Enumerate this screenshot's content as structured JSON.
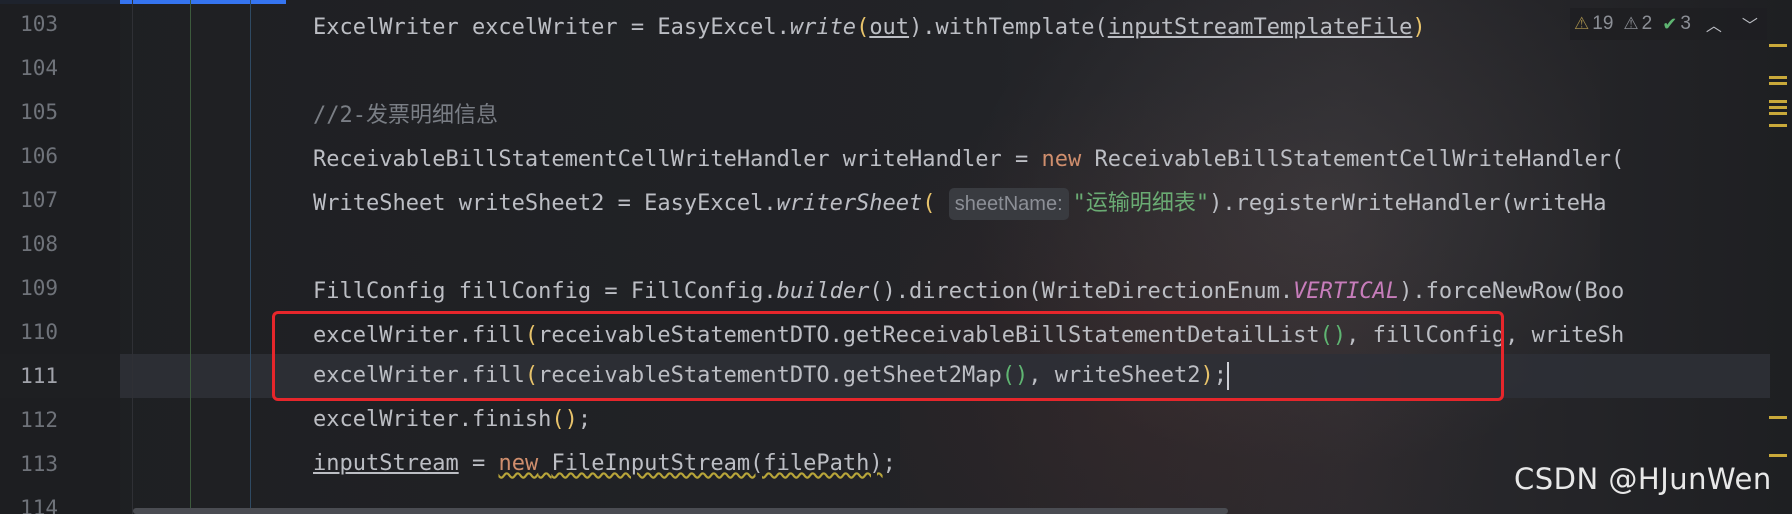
{
  "editor": {
    "line_numbers": [
      "103",
      "104",
      "105",
      "106",
      "107",
      "108",
      "109",
      "110",
      "111",
      "112",
      "113",
      "114"
    ],
    "current_line": "111"
  },
  "code": {
    "l103": {
      "a": "ExcelWriter excelWriter = EasyExcel.",
      "b": "write",
      "c": "(",
      "d": "out",
      "e": ").withTemplate(",
      "f": "inputStreamTemplateFile",
      "g": ")"
    },
    "l105": {
      "comment": "//2-发票明细信息"
    },
    "l106": {
      "a": "ReceivableBillStatementCellWriteHandler writeHandler = ",
      "kw": "new",
      "b": " ReceivableBillStatementCellWriteHandler("
    },
    "l107": {
      "a": "WriteSheet writeSheet2 = EasyExcel.",
      "b": "writerSheet",
      "c": "(",
      "hint": "sheetName:",
      "str": "\"运输明细表\"",
      "d": ").registerWriteHandler(writeHa"
    },
    "l109": {
      "a": "FillConfig fillConfig = FillConfig.",
      "b": "builder",
      "c": "().direction(WriteDirectionEnum.",
      "const": "VERTICAL",
      "d": ").forceNewRow(Boo"
    },
    "l110": {
      "a": "excelWriter.fill",
      "b": "(",
      "c": "receivableStatementDTO.getReceivableBillStatementDetailList",
      "d": "()",
      "e": ", fillConfig, writeSh"
    },
    "l111": {
      "a": "excelWriter.fill",
      "b": "(",
      "c": "receivableStatementDTO.getSheet2Map",
      "d": "()",
      "e": ", writeSheet2",
      "f": ")",
      "g": ";"
    },
    "l112": {
      "a": "excelWriter.finish",
      "b": "()",
      "c": ";"
    },
    "l113": {
      "a": "inputStream",
      "b": " = ",
      "kw": "new",
      "c": " ",
      "d": "FileInputStream(filePath)",
      "e": ";"
    }
  },
  "inspections": {
    "warnings": "19",
    "weak_warnings": "2",
    "ok": "3",
    "warn_icon": "warning-triangle-icon",
    "ok_icon": "check-icon"
  },
  "watermark": "CSDN @HJunWen",
  "colors": {
    "keyword": "#cf8e6d",
    "string": "#6aab73",
    "comment": "#7a7e85",
    "highlight_box": "#e6262b",
    "accent": "#3574f0"
  }
}
